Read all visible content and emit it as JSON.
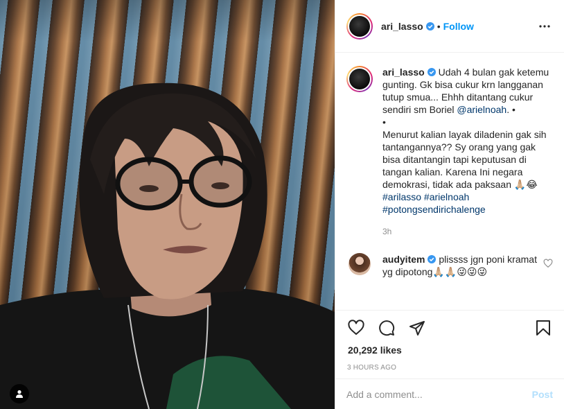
{
  "header": {
    "username": "ari_lasso",
    "separator": "•",
    "follow_label": "Follow",
    "more_icon": "more-options-icon"
  },
  "caption": {
    "username": "ari_lasso",
    "text_1": "Udah 4 bulan gak ketemu gunting. Gk bisa cukur krn langganan tutup smua... Ehhh ditantang cukur sendiri sm Boriel",
    "mention": "@arielnoah",
    "text_2": ". •",
    "text_3": "•",
    "text_4": "Menurut kalian layak diladenin gak sih tantangannya?? Sy orang yang gak bisa ditantangin tapi keputusan di tangan kalian. Karena Ini negara demokrasi, tidak ada paksaan 🙏🏼😂",
    "hashtag_1": "#arilasso",
    "hashtag_2": "#arielnoah",
    "hashtag_3": "#potongsendirichalenge",
    "time": "3h"
  },
  "comments": [
    {
      "username": "audyitem",
      "text": "plissss jgn poni kramat yg dipotong🙏🏼🙏🏼😜😜😜"
    }
  ],
  "actions": {
    "like_icon": "heart-icon",
    "comment_icon": "comment-icon",
    "share_icon": "share-icon",
    "save_icon": "bookmark-icon"
  },
  "likes": "20,292 likes",
  "timestamp": "3 HOURS AGO",
  "add_comment": {
    "placeholder": "Add a comment...",
    "post_label": "Post"
  },
  "colors": {
    "accent": "#0095f6",
    "post_disabled": "#b2dffc",
    "muted": "#8e8e8e",
    "link": "#00376b"
  }
}
